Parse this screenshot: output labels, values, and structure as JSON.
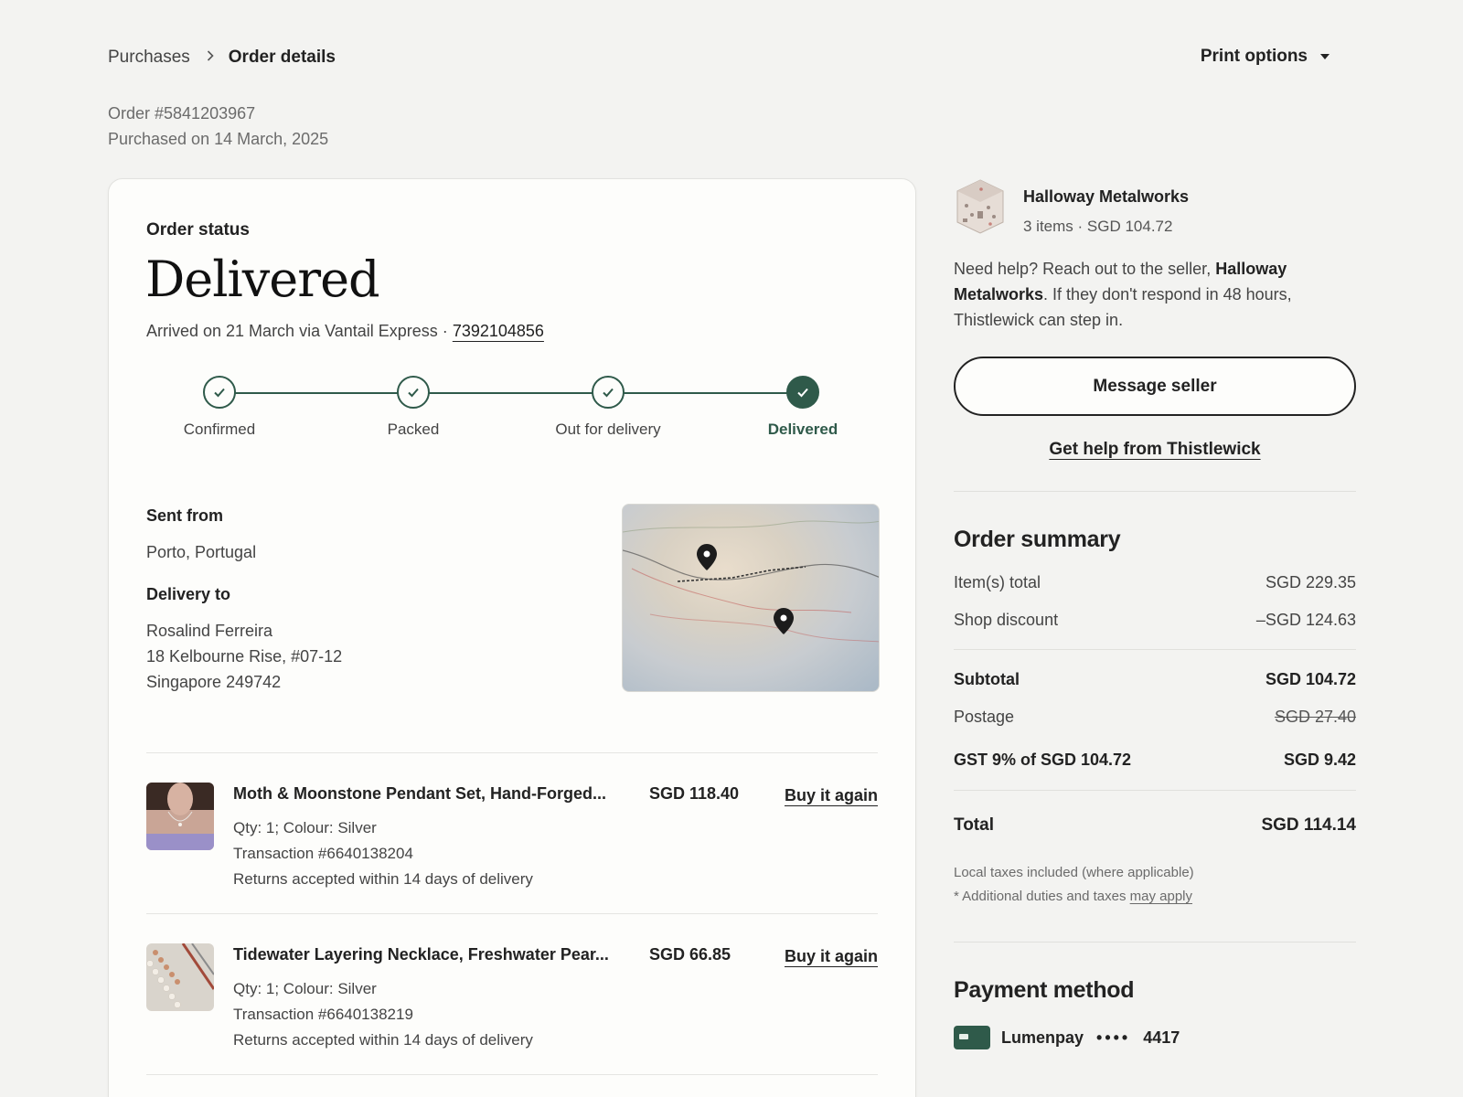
{
  "breadcrumb": {
    "parent": "Purchases",
    "current": "Order details"
  },
  "print_options": "Print options",
  "order": {
    "number": "Order #5841203967",
    "purchased": "Purchased on 14 March, 2025"
  },
  "status": {
    "label": "Order status",
    "value": "Delivered",
    "arrived_prefix": "Arrived on 21 March via Vantail Express · ",
    "tracking": "7392104856",
    "steps": [
      "Confirmed",
      "Packed",
      "Out for delivery",
      "Delivered"
    ]
  },
  "shipping": {
    "sent_from_label": "Sent from",
    "sent_from": "Porto, Portugal",
    "delivery_to_label": "Delivery to",
    "name": "Rosalind Ferreira",
    "address1": "18 Kelbourne Rise, #07-12",
    "address2": "Singapore 249742"
  },
  "items": [
    {
      "title": "Moth & Moonstone Pendant Set, Hand-Forged...",
      "price": "SGD 118.40",
      "buy": "Buy it again",
      "qty": "Qty: 1; Colour: Silver",
      "transaction": "Transaction #6640138204",
      "returns": "Returns accepted within 14 days of delivery"
    },
    {
      "title": "Tidewater Layering Necklace, Freshwater Pear...",
      "price": "SGD 66.85",
      "buy": "Buy it again",
      "qty": "Qty: 1; Colour: Silver",
      "transaction": "Transaction #6640138219",
      "returns": "Returns accepted within 14 days of delivery"
    }
  ],
  "shop": {
    "name": "Halloway Metalworks",
    "sub": "3 items · SGD 104.72",
    "help_pre": "Need help? Reach out to the seller, ",
    "help_name": "Halloway Metalworks",
    "help_post": ". If they don't respond in 48 hours, Thistlewick can step in.",
    "message_btn": "Message seller",
    "help_link": "Get help from Thistlewick"
  },
  "summary": {
    "title": "Order summary",
    "items_total_label": "Item(s) total",
    "items_total": "SGD 229.35",
    "discount_label": "Shop discount",
    "discount": "–SGD 124.63",
    "subtotal_label": "Subtotal",
    "subtotal": "SGD 104.72",
    "postage_label": "Postage",
    "postage": "SGD 27.40",
    "gst_label": "GST 9% of SGD 104.72",
    "gst": "SGD 9.42",
    "total_label": "Total",
    "total": "SGD 114.14",
    "fine1": "Local taxes included (where applicable)",
    "fine2_pre": "* Additional duties and taxes ",
    "fine2_link": "may apply"
  },
  "payment": {
    "title": "Payment method",
    "brand": "Lumenpay",
    "dots": "••••",
    "last4": "4417"
  },
  "colors": {
    "accent": "#2f5a4a",
    "background": "#f3f3f1",
    "card": "#fdfdfb"
  },
  "icons": [
    "chevron-right-icon",
    "caret-down-icon",
    "check-icon",
    "map-pin-icon",
    "card-icon"
  ]
}
